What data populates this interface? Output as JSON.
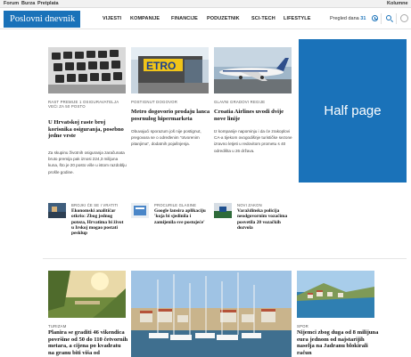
{
  "topbar": {
    "links": [
      "Forum",
      "Burza",
      "Pretplata"
    ],
    "right_link": "Kolumne"
  },
  "header": {
    "logo": "Poslovni dnevnik",
    "nav": [
      "VIJESTI",
      "KOMPANIJE",
      "FINANCIJE",
      "PODUZETNIK",
      "SCI-TECH",
      "LIFESTYLE"
    ],
    "pregled_label": "Pregled dana",
    "pregled_count": "31"
  },
  "articles": [
    {
      "category": "RAST PREMIJE 1 OSIGURAVATELJA VEĆI ZA 50 POSTO",
      "title": "U Hrvatskoj raste broj korisnika osiguranja, posebno jedne vrste",
      "excerpt": "Za skupinu životnih osiguranja zaračunata bruto premija pak iznosi 224,3 milijuna kuna, što je 20 posto više u istom razdoblju prošle godine."
    },
    {
      "category": "POSTIGNUT DOGOVOR",
      "title": "Metro dogovorio prodaju lanca posrnulog hipermarketa",
      "excerpt": "Obuvajući sporazum još nije postignut, pregovara se o određenim \"otvorenim pitanjima\", dodatnih pojašnjenja."
    },
    {
      "category": "GLAVNI GRADOVI REGIJE",
      "title": "Croatia Airlines uvodi dvije nove linije",
      "excerpt": "Iz kompanije napominju i da će zrakoplovi CA-a tijekom ovogodišnje turističke sezone izravno letjeti u redovitom prometu s 40 odredišta u 26 država."
    }
  ],
  "ad": {
    "label": "Half page"
  },
  "mini_articles": [
    {
      "category": "BROJKI ĆE SE I VRATITI",
      "title": "Ekonomski analitičar otkrio: Zbog jednog potеza, Hrvatima bi život u Irskoj mogao postati pesklup"
    },
    {
      "category": "PROCURILE GLASINE",
      "title": "Google lansira aplikaciju 'koja bi sjedinila i zamijenila sve postojeće'"
    },
    {
      "category": "NOVI ZAKON",
      "title": "Varaždinska policija neodgovornim vozačima posvetila 20 vozačkih dozvola"
    }
  ],
  "bottom_articles": [
    {
      "category": "TURIZAM",
      "title": "Planira se graditi 46 vikendica površine od 50 do 110 četvornih metara, a cijena po kvadratu na granu biti viša od"
    },
    {
      "category": "SPOR",
      "title": "Nijemci zbog duga od 8 milijuna eura jednom od najstarijih naselja na Jadranu blokirali račun"
    }
  ]
}
